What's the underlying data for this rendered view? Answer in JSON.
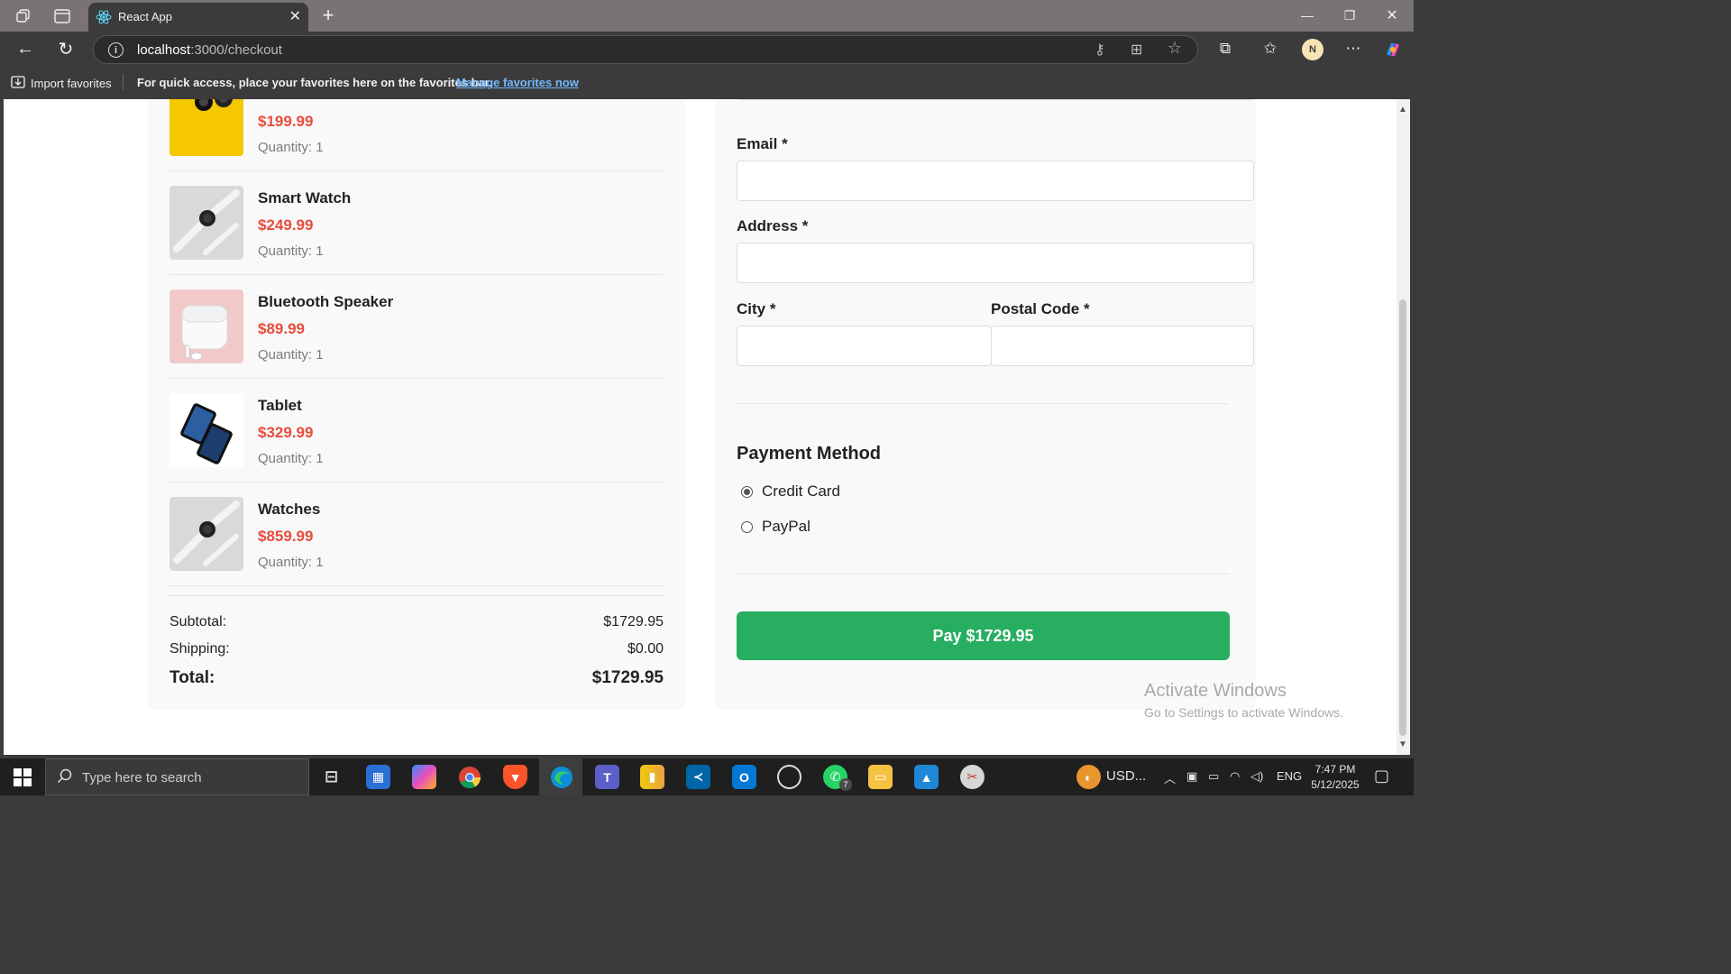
{
  "browser": {
    "tab_title": "React App",
    "url_host": "localhost",
    "url_path": ":3000/checkout",
    "avatar_initial": "N",
    "favorites": {
      "import_label": "Import favorites",
      "hint": "For quick access, place your favorites here on the favorites bar.",
      "manage_link": "Manage favorites now"
    }
  },
  "cart": {
    "items": [
      {
        "name": "",
        "price": "$199.99",
        "quantity": "Quantity: 1",
        "image": "headphones-image",
        "accent": "#f6c800"
      },
      {
        "name": "Smart Watch",
        "price": "$249.99",
        "quantity": "Quantity: 1",
        "image": "smart-watch-image",
        "accent": "#d9d9d9"
      },
      {
        "name": "Bluetooth Speaker",
        "price": "$89.99",
        "quantity": "Quantity: 1",
        "image": "earbuds-image",
        "accent": "#f1c9c9"
      },
      {
        "name": "Tablet",
        "price": "$329.99",
        "quantity": "Quantity: 1",
        "image": "phones-image",
        "accent": "#ffffff"
      },
      {
        "name": "Watches",
        "price": "$859.99",
        "quantity": "Quantity: 1",
        "image": "smart-watch-image",
        "accent": "#d9d9d9"
      }
    ],
    "summary": {
      "subtotal_label": "Subtotal:",
      "subtotal_value": "$1729.95",
      "shipping_label": "Shipping:",
      "shipping_value": "$0.00",
      "total_label": "Total:",
      "total_value": "$1729.95"
    }
  },
  "form": {
    "email_label": "Email *",
    "address_label": "Address *",
    "city_label": "City *",
    "postal_label": "Postal Code *",
    "email_value": "",
    "address_value": "",
    "city_value": "",
    "postal_value": ""
  },
  "payment": {
    "title": "Payment Method",
    "options": [
      {
        "label": "Credit Card",
        "selected": true
      },
      {
        "label": "PayPal",
        "selected": false
      }
    ],
    "pay_button": "Pay $1729.95",
    "accent": "#27ae60"
  },
  "watermark": {
    "line1": "Activate Windows",
    "line2": "Go to Settings to activate Windows."
  },
  "taskbar": {
    "search_placeholder": "Type here to search",
    "weather": "USD...",
    "language": "ENG",
    "time": "7:47 PM",
    "date": "5/12/2025",
    "whatsapp_badge": "7"
  },
  "colors": {
    "price": "#e74c3c",
    "link": "#73b8ff"
  }
}
